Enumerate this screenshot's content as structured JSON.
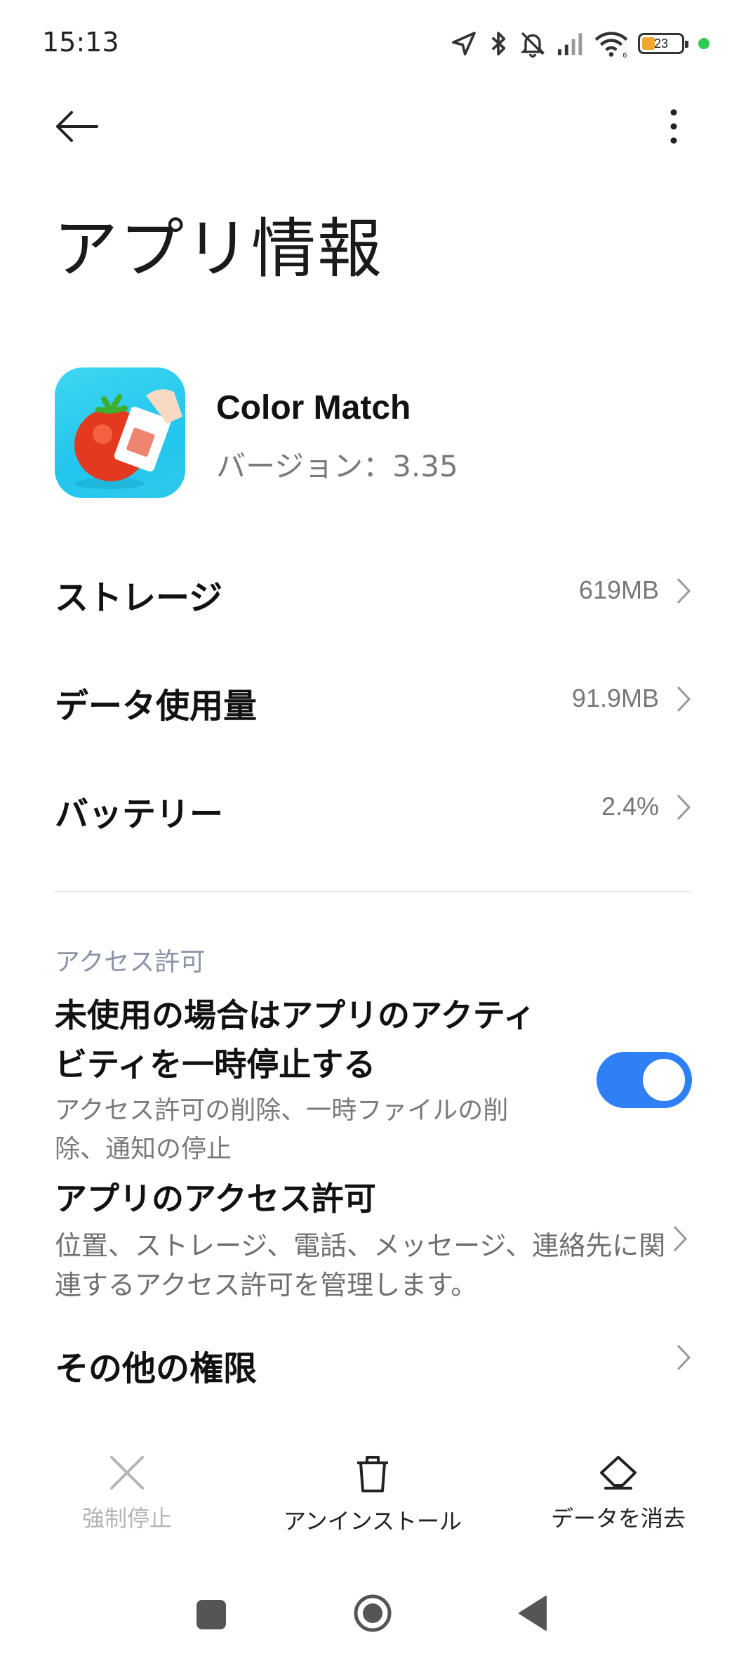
{
  "status_bar": {
    "time": "15:13",
    "battery_level": "23",
    "icons": [
      "location-icon",
      "bluetooth-icon",
      "mute-icon",
      "signal-icon",
      "wifi-icon",
      "battery-icon"
    ]
  },
  "header": {
    "title": "アプリ情報"
  },
  "app": {
    "name": "Color Match",
    "version": "バージョン：3.35"
  },
  "rows": [
    {
      "label": "ストレージ",
      "value": "619MB"
    },
    {
      "label": "データ使用量",
      "value": "91.9MB"
    },
    {
      "label": "バッテリー",
      "value": "2.4%"
    }
  ],
  "permissions": {
    "section_title": "アクセス許可",
    "pause_title": "未使用の場合はアプリのアクティビティを一時停止する",
    "pause_desc": "アクセス許可の削除、一時ファイルの削除、通知の停止",
    "pause_enabled": true,
    "app_perm_title": "アプリのアクセス許可",
    "app_perm_desc": "位置、ストレージ、電話、メッセージ、連絡先に関連するアクセス許可を管理します。",
    "other_title": "その他の権限"
  },
  "actions": {
    "force_stop": "強制停止",
    "uninstall": "アンインストール",
    "clear_data": "データを消去"
  },
  "colors": {
    "accent": "#2f7ff6",
    "section_header": "#8a93a8",
    "secondary_text": "#7a7a7a"
  }
}
